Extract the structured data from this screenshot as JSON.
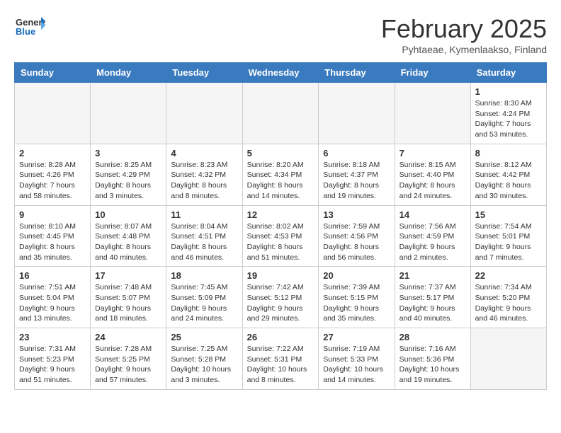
{
  "header": {
    "logo_general": "General",
    "logo_blue": "Blue",
    "month_title": "February 2025",
    "location": "Pyhtaeae, Kymenlaakso, Finland"
  },
  "calendar": {
    "days_of_week": [
      "Sunday",
      "Monday",
      "Tuesday",
      "Wednesday",
      "Thursday",
      "Friday",
      "Saturday"
    ],
    "weeks": [
      [
        {
          "day": "",
          "info": ""
        },
        {
          "day": "",
          "info": ""
        },
        {
          "day": "",
          "info": ""
        },
        {
          "day": "",
          "info": ""
        },
        {
          "day": "",
          "info": ""
        },
        {
          "day": "",
          "info": ""
        },
        {
          "day": "1",
          "info": "Sunrise: 8:30 AM\nSunset: 4:24 PM\nDaylight: 7 hours and 53 minutes."
        }
      ],
      [
        {
          "day": "2",
          "info": "Sunrise: 8:28 AM\nSunset: 4:26 PM\nDaylight: 7 hours and 58 minutes."
        },
        {
          "day": "3",
          "info": "Sunrise: 8:25 AM\nSunset: 4:29 PM\nDaylight: 8 hours and 3 minutes."
        },
        {
          "day": "4",
          "info": "Sunrise: 8:23 AM\nSunset: 4:32 PM\nDaylight: 8 hours and 8 minutes."
        },
        {
          "day": "5",
          "info": "Sunrise: 8:20 AM\nSunset: 4:34 PM\nDaylight: 8 hours and 14 minutes."
        },
        {
          "day": "6",
          "info": "Sunrise: 8:18 AM\nSunset: 4:37 PM\nDaylight: 8 hours and 19 minutes."
        },
        {
          "day": "7",
          "info": "Sunrise: 8:15 AM\nSunset: 4:40 PM\nDaylight: 8 hours and 24 minutes."
        },
        {
          "day": "8",
          "info": "Sunrise: 8:12 AM\nSunset: 4:42 PM\nDaylight: 8 hours and 30 minutes."
        }
      ],
      [
        {
          "day": "9",
          "info": "Sunrise: 8:10 AM\nSunset: 4:45 PM\nDaylight: 8 hours and 35 minutes."
        },
        {
          "day": "10",
          "info": "Sunrise: 8:07 AM\nSunset: 4:48 PM\nDaylight: 8 hours and 40 minutes."
        },
        {
          "day": "11",
          "info": "Sunrise: 8:04 AM\nSunset: 4:51 PM\nDaylight: 8 hours and 46 minutes."
        },
        {
          "day": "12",
          "info": "Sunrise: 8:02 AM\nSunset: 4:53 PM\nDaylight: 8 hours and 51 minutes."
        },
        {
          "day": "13",
          "info": "Sunrise: 7:59 AM\nSunset: 4:56 PM\nDaylight: 8 hours and 56 minutes."
        },
        {
          "day": "14",
          "info": "Sunrise: 7:56 AM\nSunset: 4:59 PM\nDaylight: 9 hours and 2 minutes."
        },
        {
          "day": "15",
          "info": "Sunrise: 7:54 AM\nSunset: 5:01 PM\nDaylight: 9 hours and 7 minutes."
        }
      ],
      [
        {
          "day": "16",
          "info": "Sunrise: 7:51 AM\nSunset: 5:04 PM\nDaylight: 9 hours and 13 minutes."
        },
        {
          "day": "17",
          "info": "Sunrise: 7:48 AM\nSunset: 5:07 PM\nDaylight: 9 hours and 18 minutes."
        },
        {
          "day": "18",
          "info": "Sunrise: 7:45 AM\nSunset: 5:09 PM\nDaylight: 9 hours and 24 minutes."
        },
        {
          "day": "19",
          "info": "Sunrise: 7:42 AM\nSunset: 5:12 PM\nDaylight: 9 hours and 29 minutes."
        },
        {
          "day": "20",
          "info": "Sunrise: 7:39 AM\nSunset: 5:15 PM\nDaylight: 9 hours and 35 minutes."
        },
        {
          "day": "21",
          "info": "Sunrise: 7:37 AM\nSunset: 5:17 PM\nDaylight: 9 hours and 40 minutes."
        },
        {
          "day": "22",
          "info": "Sunrise: 7:34 AM\nSunset: 5:20 PM\nDaylight: 9 hours and 46 minutes."
        }
      ],
      [
        {
          "day": "23",
          "info": "Sunrise: 7:31 AM\nSunset: 5:23 PM\nDaylight: 9 hours and 51 minutes."
        },
        {
          "day": "24",
          "info": "Sunrise: 7:28 AM\nSunset: 5:25 PM\nDaylight: 9 hours and 57 minutes."
        },
        {
          "day": "25",
          "info": "Sunrise: 7:25 AM\nSunset: 5:28 PM\nDaylight: 10 hours and 3 minutes."
        },
        {
          "day": "26",
          "info": "Sunrise: 7:22 AM\nSunset: 5:31 PM\nDaylight: 10 hours and 8 minutes."
        },
        {
          "day": "27",
          "info": "Sunrise: 7:19 AM\nSunset: 5:33 PM\nDaylight: 10 hours and 14 minutes."
        },
        {
          "day": "28",
          "info": "Sunrise: 7:16 AM\nSunset: 5:36 PM\nDaylight: 10 hours and 19 minutes."
        },
        {
          "day": "",
          "info": ""
        }
      ]
    ]
  }
}
